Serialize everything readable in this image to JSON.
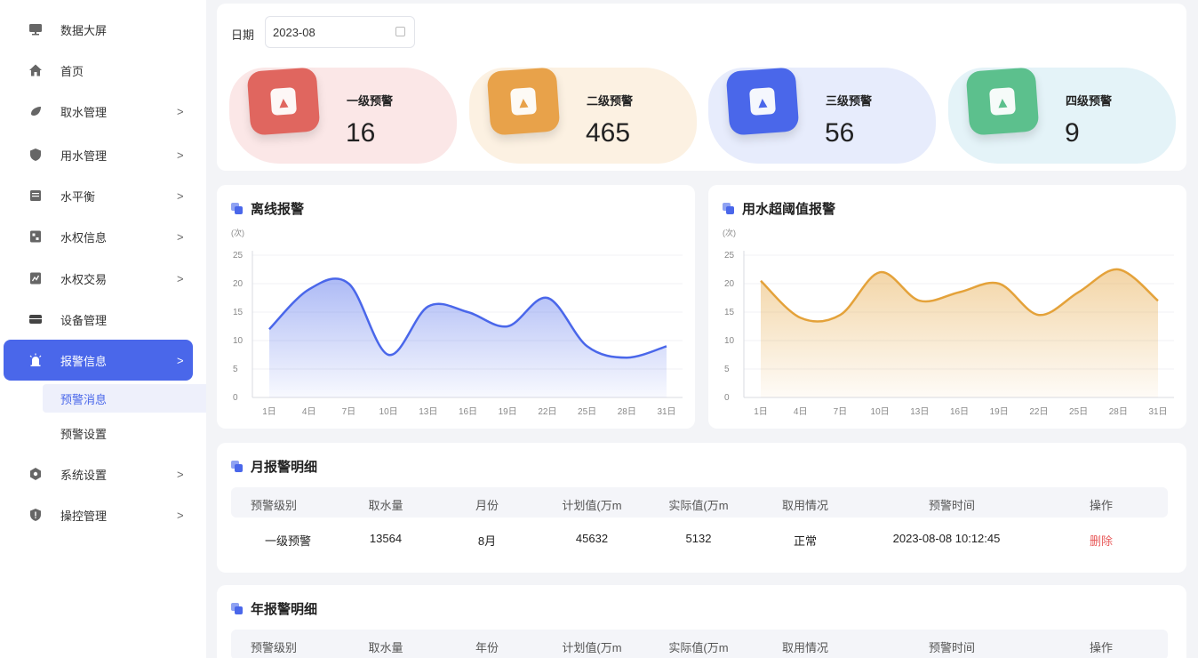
{
  "sidebar": {
    "items": [
      {
        "label": "数据大屏",
        "icon": "monitor-icon"
      },
      {
        "label": "首页",
        "icon": "home-icon"
      },
      {
        "label": "取水管理",
        "icon": "water-drop-icon"
      },
      {
        "label": "用水管理",
        "icon": "shield-icon"
      },
      {
        "label": "水平衡",
        "icon": "balance-icon"
      },
      {
        "label": "水权信息",
        "icon": "document-icon"
      },
      {
        "label": "水权交易",
        "icon": "trade-icon"
      },
      {
        "label": "设备管理",
        "icon": "device-icon"
      },
      {
        "label": "报警信息",
        "icon": "alarm-icon"
      },
      {
        "label": "系统设置",
        "icon": "settings-icon"
      },
      {
        "label": "操控管理",
        "icon": "control-icon"
      }
    ],
    "submenu": [
      {
        "label": "预警消息"
      },
      {
        "label": "预警设置"
      }
    ],
    "chevron": ">"
  },
  "filter": {
    "date_label": "日期",
    "date_value": "2023-08"
  },
  "stats": [
    {
      "label": "一级预警",
      "value": "16",
      "color": "#e0665f",
      "bg": "#fbe7e7"
    },
    {
      "label": "二级预警",
      "value": "465",
      "color": "#e8a24a",
      "bg": "#fcf1e2"
    },
    {
      "label": "三级预警",
      "value": "56",
      "color": "#4a67ea",
      "bg": "#e7ecfc"
    },
    {
      "label": "四级预警",
      "value": "9",
      "color": "#5cc08d",
      "bg": "#e4f3f8"
    }
  ],
  "charts": {
    "offline": {
      "title": "离线报警",
      "unit": "(次)"
    },
    "threshold": {
      "title": "用水超阈值报警",
      "unit": "(次)"
    }
  },
  "chart_data": [
    {
      "type": "area",
      "title": "离线报警",
      "ylabel": "(次)",
      "x": [
        "1日",
        "4日",
        "7日",
        "10日",
        "13日",
        "16日",
        "19日",
        "22日",
        "25日",
        "28日",
        "31日"
      ],
      "yticks": [
        0,
        5,
        10,
        15,
        20,
        25
      ],
      "ylim": [
        0,
        25
      ],
      "series": [
        {
          "values": [
            12,
            19,
            20,
            7.5,
            16,
            15,
            12.5,
            17.5,
            9,
            7,
            9
          ],
          "color": "#4a67ea"
        }
      ]
    },
    {
      "type": "area",
      "title": "用水超阈值报警",
      "ylabel": "(次)",
      "x": [
        "1日",
        "4日",
        "7日",
        "10日",
        "13日",
        "16日",
        "19日",
        "22日",
        "25日",
        "28日",
        "31日"
      ],
      "yticks": [
        0,
        5,
        10,
        15,
        20,
        25
      ],
      "ylim": [
        0,
        25
      ],
      "series": [
        {
          "values": [
            20.5,
            14,
            14.5,
            22,
            17,
            18.5,
            20,
            14.5,
            18.5,
            22.5,
            17
          ],
          "color": "#e4a23a"
        }
      ]
    }
  ],
  "monthly": {
    "title": "月报警明细",
    "headers": [
      "预警级别",
      "取水量",
      "月份",
      "计划值(万m",
      "实际值(万m",
      "取用情况",
      "预警时间",
      "操作"
    ],
    "rows": [
      [
        "一级预警",
        "13564",
        "8月",
        "45632",
        "5132",
        "正常",
        "2023-08-08 10:12:45",
        "删除"
      ]
    ]
  },
  "yearly": {
    "title": "年报警明细",
    "headers": [
      "预警级别",
      "取水量",
      "年份",
      "计划值(万m",
      "实际值(万m",
      "取用情况",
      "预警时间",
      "操作"
    ]
  }
}
